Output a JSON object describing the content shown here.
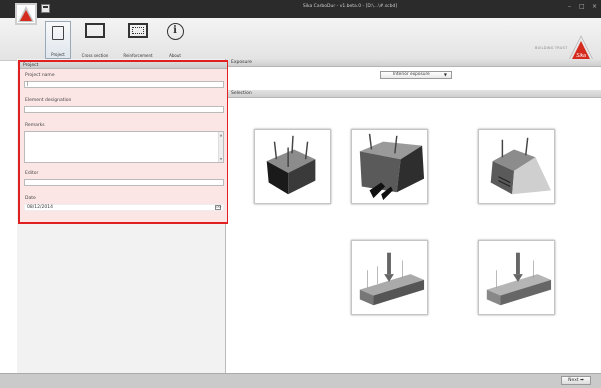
{
  "window": {
    "title": "Sika CarboDur - v1.beta.0 - [D:\\...\\#.scbd]",
    "minimize": "–",
    "maximize": "□",
    "close": "×"
  },
  "ribbon": {
    "items": [
      {
        "label": "Project",
        "icon": "project-icon"
      },
      {
        "label": "Cross section",
        "icon": "cross-section-icon"
      },
      {
        "label": "Reinforcement",
        "icon": "reinforcement-icon"
      },
      {
        "label": "About",
        "icon": "info-icon"
      }
    ],
    "about_glyph": "i",
    "brand_tagline": "BUILDING TRUST",
    "brand_name": "Sika"
  },
  "project": {
    "header": "Project",
    "project_name_label": "Project name",
    "project_name_value": "|",
    "element_label": "Element designation",
    "element_value": "",
    "remarks_label": "Remarks",
    "remarks_value": "",
    "editor_label": "Editor",
    "editor_value": "",
    "date_label": "Date",
    "date_value": "08/12/2014",
    "date_picker_glyph": "15▾"
  },
  "exposure": {
    "header": "Exposure",
    "selected": "Interior exposure"
  },
  "selection": {
    "header": "Selection"
  },
  "footer": {
    "next_label": "Next ➡"
  },
  "colors": {
    "highlight_border": "#e02020",
    "highlight_fill": "#fbe5e5",
    "titlebar": "#2b2b2b"
  }
}
